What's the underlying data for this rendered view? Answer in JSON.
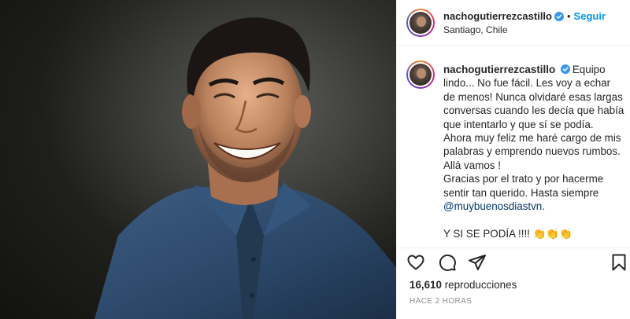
{
  "post": {
    "username": "nachogutierrezcastillo",
    "follow_label": "Seguir",
    "dot": "•",
    "location": "Santiago, Chile"
  },
  "caption": {
    "username": "nachogutierrezcastillo",
    "lines": [
      "Equipo lindo... No fue fácil. Les voy a echar de menos! Nunca olvidaré esas largas conversas cuando les decía que había que intentarlo y que sí se podía.",
      "Ahora muy feliz me haré cargo de mis palabras y emprendo nuevos rumbos. Allá vamos !",
      "Gracias por el trato y por hacerme sentir tan querido. Hasta siempre"
    ],
    "mention": "@muybuenosdiastvn",
    "mention_suffix": ".",
    "closing": "Y SI SE PODÍA !!!! 👏👏👏"
  },
  "stats": {
    "views_count": "16,610",
    "views_label": "reproducciones",
    "time": "HACE 2 HORAS"
  },
  "icons": {
    "verified": "verified-badge-icon",
    "like": "heart-icon",
    "comment": "comment-icon",
    "share": "paper-plane-icon",
    "save": "bookmark-icon"
  },
  "colors": {
    "link_blue": "#0095f6",
    "verified_blue": "#3897f0",
    "shirt_blue": "#2e4a6b",
    "mention_blue": "#00376b"
  }
}
